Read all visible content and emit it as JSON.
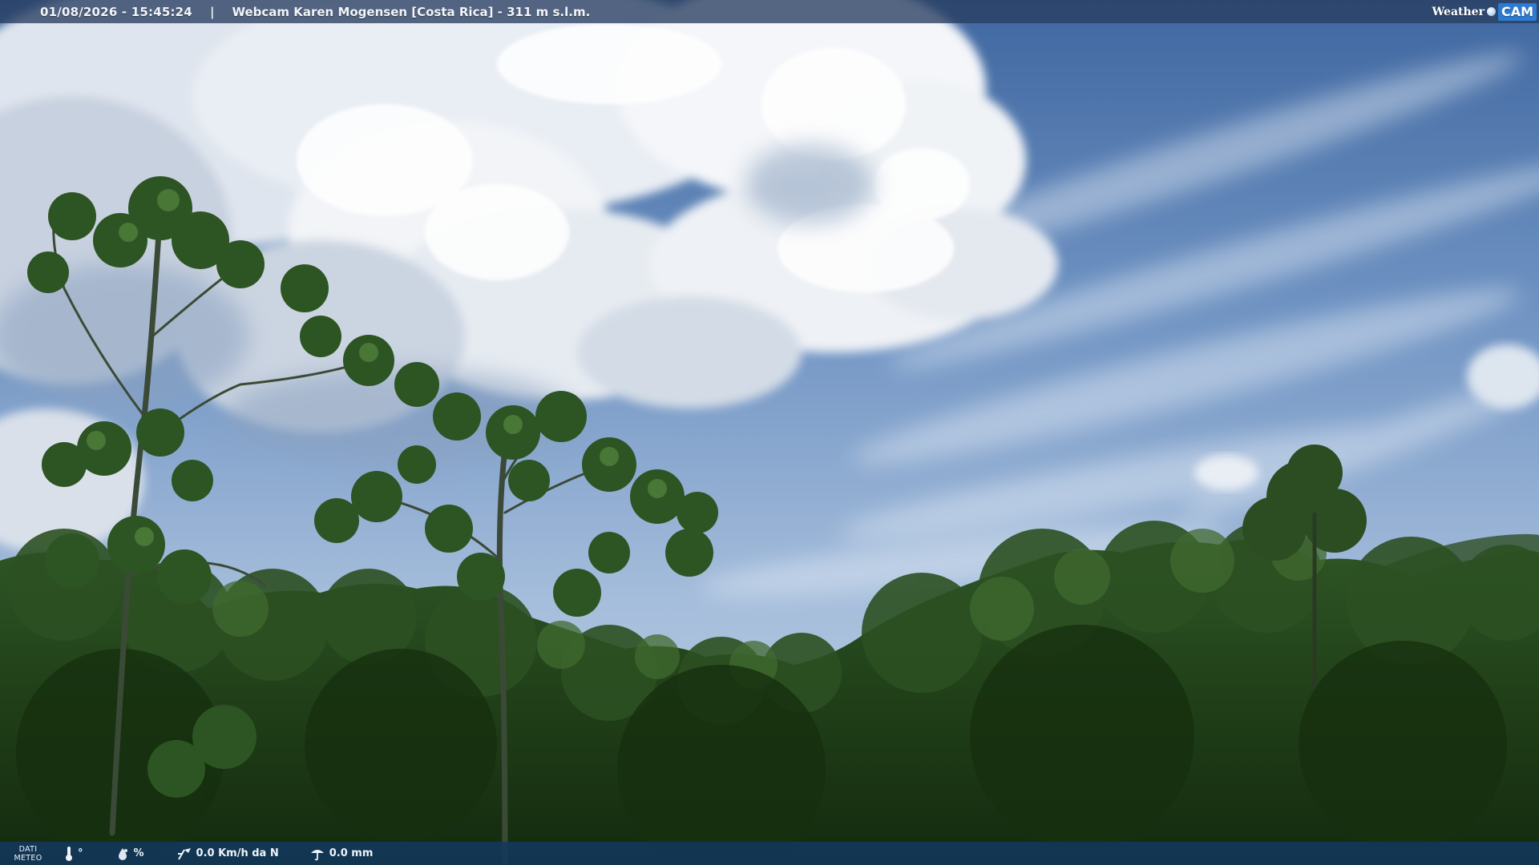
{
  "overlay": {
    "timestamp": "01/08/2026 - 15:45:24",
    "separator": "|",
    "location": "Webcam Karen Mogensen [Costa Rica] - 311 m s.l.m.",
    "brand_weather": "Weather",
    "brand_cam": "CAM"
  },
  "weather": {
    "section_label_1": "DATI",
    "section_label_2": "METEO",
    "temperature_unit": "°",
    "humidity_unit": "%",
    "wind": "0.0 Km/h da N",
    "rain": "0.0 mm"
  },
  "icons": {
    "temperature": "thermometer-icon",
    "humidity": "water-drop-icon",
    "wind": "wind-vane-icon",
    "rain": "rain-gauge-icon",
    "brand": "weathercam-logo-icon"
  },
  "colors": {
    "sky_top": "#4a72a8",
    "sky_mid": "#7d9ec8",
    "sky_low": "#b3c8de",
    "cloud": "#f3f5f8",
    "foliage_dark": "#1b3414",
    "foliage_mid": "#2f5324",
    "foliage_light": "#4a7636",
    "bar_bottom": "#12385c",
    "brand_accent": "#2d7ad0"
  }
}
